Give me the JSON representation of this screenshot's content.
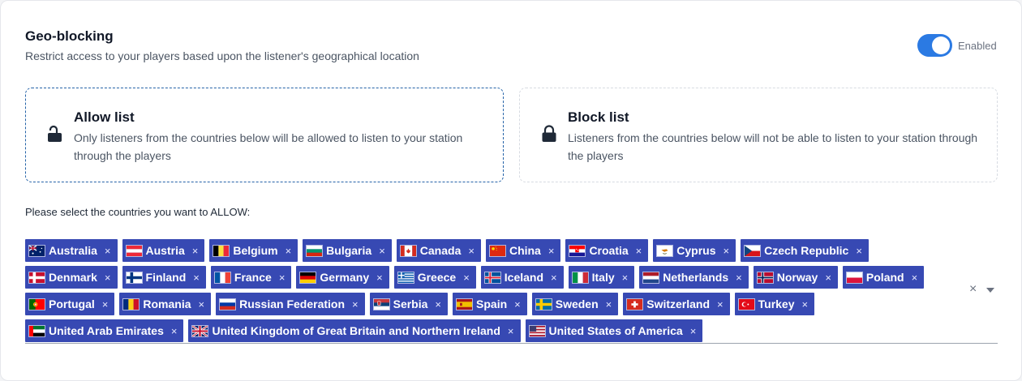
{
  "header": {
    "title": "Geo-blocking",
    "subtitle": "Restrict access to your players based upon the listener's geographical location"
  },
  "toggle": {
    "label": "Enabled",
    "on": true,
    "color": "#2b7ae3"
  },
  "modes": {
    "allow": {
      "title": "Allow list",
      "description": "Only listeners from the countries below will be allowed to listen to your station through the players",
      "icon": "unlock-icon",
      "selected": true
    },
    "block": {
      "title": "Block list",
      "description": "Listeners from the countries below will not be able to listen to your station through the players",
      "icon": "lock-icon",
      "selected": false
    }
  },
  "prompt": "Please select the countries you want to ALLOW:",
  "tag_color": "#3749b3",
  "remove_symbol": "×",
  "clear_symbol": "×",
  "countries": [
    {
      "name": "Australia",
      "flag": "australia-flag"
    },
    {
      "name": "Austria",
      "flag": "austria-flag"
    },
    {
      "name": "Belgium",
      "flag": "belgium-flag"
    },
    {
      "name": "Bulgaria",
      "flag": "bulgaria-flag"
    },
    {
      "name": "Canada",
      "flag": "canada-flag"
    },
    {
      "name": "China",
      "flag": "china-flag"
    },
    {
      "name": "Croatia",
      "flag": "croatia-flag"
    },
    {
      "name": "Cyprus",
      "flag": "cyprus-flag"
    },
    {
      "name": "Czech Republic",
      "flag": "czech-flag"
    },
    {
      "name": "Denmark",
      "flag": "denmark-flag"
    },
    {
      "name": "Finland",
      "flag": "finland-flag"
    },
    {
      "name": "France",
      "flag": "france-flag"
    },
    {
      "name": "Germany",
      "flag": "germany-flag"
    },
    {
      "name": "Greece",
      "flag": "greece-flag"
    },
    {
      "name": "Iceland",
      "flag": "iceland-flag"
    },
    {
      "name": "Italy",
      "flag": "italy-flag"
    },
    {
      "name": "Netherlands",
      "flag": "netherlands-flag"
    },
    {
      "name": "Norway",
      "flag": "norway-flag"
    },
    {
      "name": "Poland",
      "flag": "poland-flag"
    },
    {
      "name": "Portugal",
      "flag": "portugal-flag"
    },
    {
      "name": "Romania",
      "flag": "romania-flag"
    },
    {
      "name": "Russian Federation",
      "flag": "russia-flag"
    },
    {
      "name": "Serbia",
      "flag": "serbia-flag"
    },
    {
      "name": "Spain",
      "flag": "spain-flag"
    },
    {
      "name": "Sweden",
      "flag": "sweden-flag"
    },
    {
      "name": "Switzerland",
      "flag": "switzerland-flag"
    },
    {
      "name": "Turkey",
      "flag": "turkey-flag"
    },
    {
      "name": "United Arab Emirates",
      "flag": "uae-flag"
    },
    {
      "name": "United Kingdom of Great Britain and Northern Ireland",
      "flag": "uk-flag"
    },
    {
      "name": "United States of America",
      "flag": "usa-flag"
    }
  ]
}
